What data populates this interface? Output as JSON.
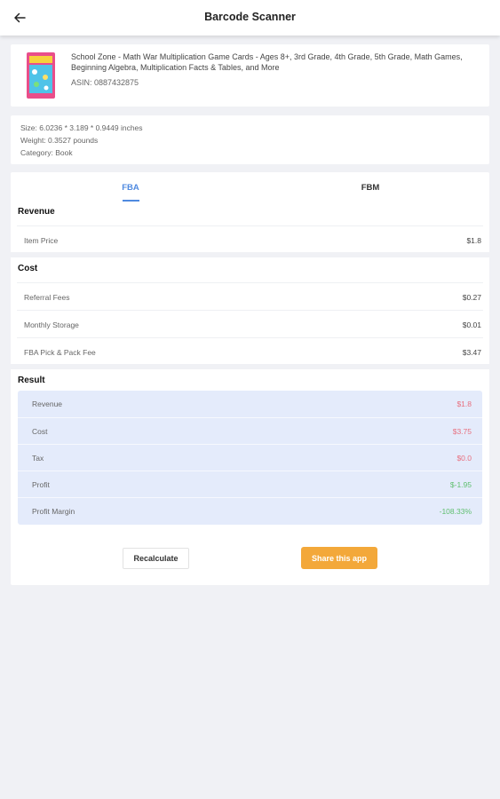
{
  "appbar": {
    "title": "Barcode Scanner",
    "back_icon": "arrow-left-icon"
  },
  "product": {
    "title": "School Zone - Math War Multiplication Game Cards - Ages 8+, 3rd Grade, 4th Grade, 5th Grade, Math Games, Beginning Algebra, Multiplication Facts & Tables, and More",
    "asin": "ASIN: 0887432875"
  },
  "specs": {
    "size": "Size: 6.0236 * 3.189 * 0.9449 inches",
    "weight": "Weight: 0.3527 pounds",
    "category": "Category: Book"
  },
  "tabs": [
    {
      "label": "FBA",
      "active": true
    },
    {
      "label": "FBM",
      "active": false
    }
  ],
  "revenue": {
    "title": "Revenue",
    "rows": [
      {
        "label": "Item Price",
        "value": "$1.8"
      }
    ]
  },
  "cost": {
    "title": "Cost",
    "rows": [
      {
        "label": "Referral Fees",
        "value": "$0.27"
      },
      {
        "label": "Monthly Storage",
        "value": "$0.01"
      },
      {
        "label": "FBA Pick & Pack Fee",
        "value": "$3.47"
      }
    ]
  },
  "result": {
    "title": "Result",
    "rows": [
      {
        "label": "Revenue",
        "value": "$1.8",
        "color": "#e8707f"
      },
      {
        "label": "Cost",
        "value": "$3.75",
        "color": "#e8707f"
      },
      {
        "label": "Tax",
        "value": "$0.0",
        "color": "#e8707f"
      },
      {
        "label": "Profit",
        "value": "$-1.95",
        "color": "#5fbf6f"
      },
      {
        "label": "Profit Margin",
        "value": "-108.33%",
        "color": "#5fbf6f"
      }
    ]
  },
  "buttons": {
    "recalculate": "Recalculate",
    "share": "Share this app"
  },
  "colors": {
    "accent": "#4f8ae0",
    "share_button": "#f3a83a",
    "result_bg": "#e4ebfb",
    "negative": "#e8707f",
    "positive": "#5fbf6f"
  }
}
